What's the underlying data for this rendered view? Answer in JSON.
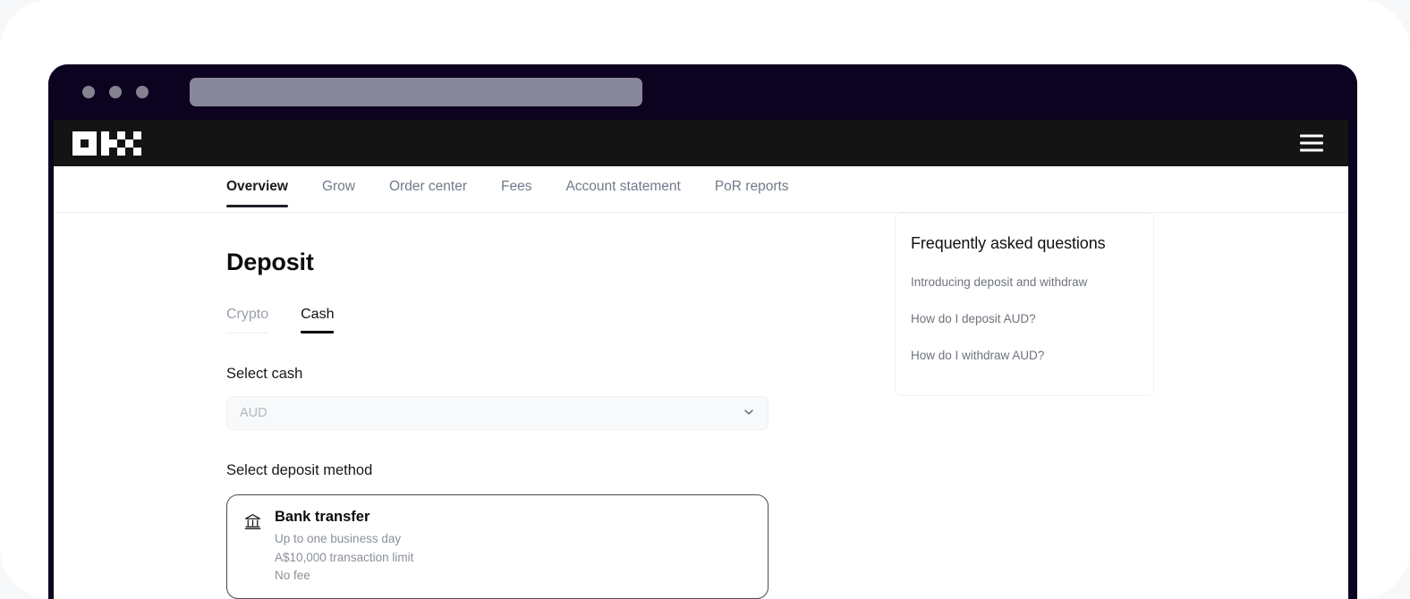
{
  "browser": {
    "traffic_lights": [
      "dot-1",
      "dot-2",
      "dot-3"
    ],
    "url_placeholder": ""
  },
  "brand": {
    "logo_name": "okx-logo",
    "menu_icon": "hamburger-menu-icon"
  },
  "nav": {
    "items": [
      {
        "label": "Overview",
        "active": true
      },
      {
        "label": "Grow",
        "active": false
      },
      {
        "label": "Order center",
        "active": false
      },
      {
        "label": "Fees",
        "active": false
      },
      {
        "label": "Account statement",
        "active": false
      },
      {
        "label": "PoR reports",
        "active": false
      }
    ]
  },
  "main": {
    "title": "Deposit",
    "subtabs": [
      {
        "label": "Crypto",
        "active": false
      },
      {
        "label": "Cash",
        "active": true
      }
    ],
    "select_cash": {
      "label": "Select cash",
      "value": "AUD",
      "placeholder": "AUD",
      "chevron_icon": "chevron-down-icon"
    },
    "deposit_method": {
      "label": "Select deposit method",
      "options": [
        {
          "icon": "bank-icon",
          "title": "Bank transfer",
          "details": [
            "Up to one business day",
            "A$10,000 transaction limit",
            "No fee"
          ]
        }
      ]
    }
  },
  "faq": {
    "title": "Frequently asked questions",
    "links": [
      "Introducing deposit and withdraw",
      "How do I deposit AUD?",
      "How do I withdraw AUD?"
    ]
  },
  "colors": {
    "chrome_dark": "#0c0320",
    "header_black": "#141414",
    "accent_text": "#1a1a1a",
    "muted_text": "#707a8a",
    "page_bg": "#f7f8f9"
  }
}
